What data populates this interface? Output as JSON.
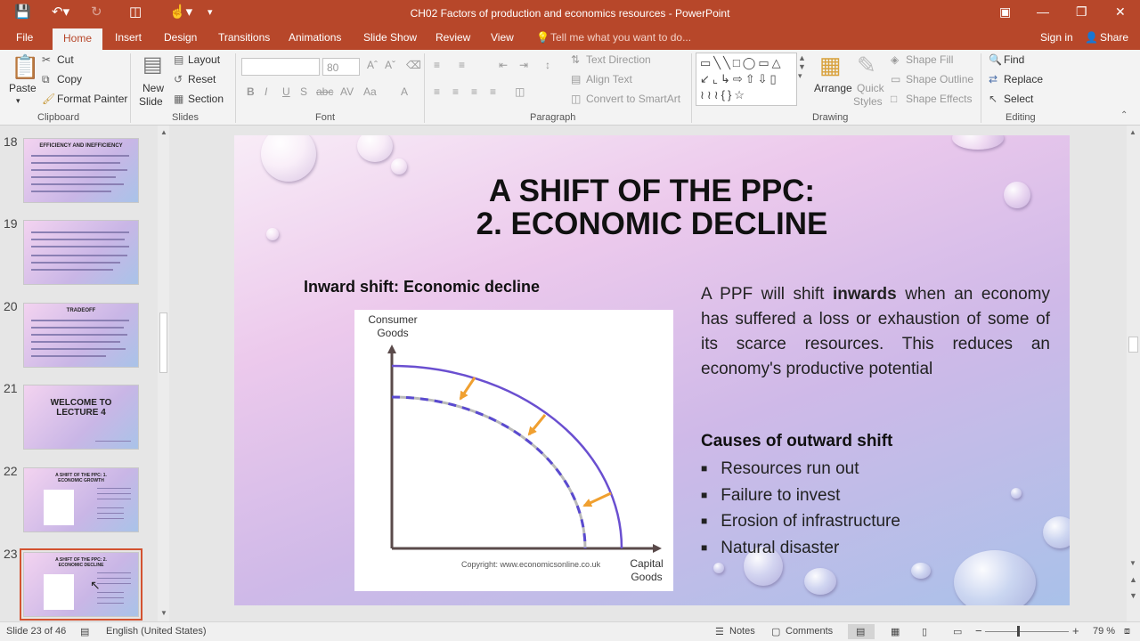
{
  "window": {
    "title": "CH02 Factors of production and economics resources - PowerPoint"
  },
  "tabs": {
    "file": "File",
    "home": "Home",
    "insert": "Insert",
    "design": "Design",
    "transitions": "Transitions",
    "animations": "Animations",
    "slideshow": "Slide Show",
    "review": "Review",
    "view": "View",
    "tellme": "Tell me what you want to do...",
    "signin": "Sign in",
    "share": "Share"
  },
  "ribbon": {
    "clipboard": {
      "paste": "Paste",
      "cut": "Cut",
      "copy": "Copy",
      "format_painter": "Format Painter",
      "label": "Clipboard"
    },
    "slides": {
      "new_slide_1": "New",
      "new_slide_2": "Slide",
      "layout": "Layout",
      "reset": "Reset",
      "section": "Section",
      "label": "Slides"
    },
    "font": {
      "size": "80",
      "label": "Font"
    },
    "paragraph": {
      "text_direction": "Text Direction",
      "align_text": "Align Text",
      "smartart": "Convert to SmartArt",
      "label": "Paragraph"
    },
    "drawing": {
      "arrange": "Arrange",
      "quick_styles_1": "Quick",
      "quick_styles_2": "Styles",
      "shape_fill": "Shape Fill",
      "shape_outline": "Shape Outline",
      "shape_effects": "Shape Effects",
      "label": "Drawing"
    },
    "editing": {
      "find": "Find",
      "replace": "Replace",
      "select": "Select",
      "label": "Editing"
    }
  },
  "thumbnails": [
    {
      "num": "18",
      "title": "EFFICIENCY AND INEFFICIENCY"
    },
    {
      "num": "19",
      "title": ""
    },
    {
      "num": "20",
      "title": "TRADEOFF"
    },
    {
      "num": "21",
      "title": "WELCOME TO LECTURE 4"
    },
    {
      "num": "22",
      "title": "A SHIFT OF THE PPC: 1. ECONOMIC GROWTH"
    },
    {
      "num": "23",
      "title": "A SHIFT OF THE PPC: 2. ECONOMIC DECLINE"
    }
  ],
  "slide": {
    "title_line1": "A SHIFT OF THE PPC:",
    "title_line2": "2. ECONOMIC DECLINE",
    "subtitle": "Inward shift: Economic decline",
    "chart": {
      "ylabel1": "Consumer",
      "ylabel2": "Goods",
      "xlabel1": "Capital",
      "xlabel2": "Goods",
      "copyright": "Copyright: www.economicsonline.co.uk"
    },
    "para_1": "A PPF will shift ",
    "para_bold": "inwards",
    "para_2": " when an economy has suffered a loss or exhaustion of some of its scarce resources. This reduces an economy's productive potential",
    "causes_heading": "Causes of outward shift",
    "bullets": [
      "Resources run out",
      "Failure to invest",
      "Erosion of infrastructure",
      "Natural disaster"
    ]
  },
  "status": {
    "slide_of": "Slide 23 of 46",
    "language": "English (United States)",
    "notes": "Notes",
    "comments": "Comments",
    "zoom": "79 %"
  }
}
